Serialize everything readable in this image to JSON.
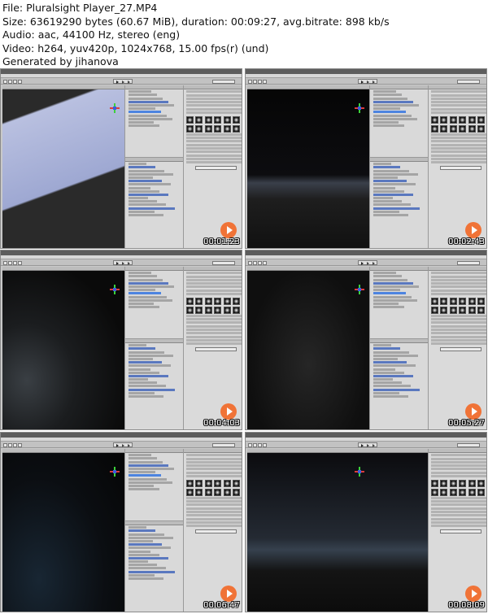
{
  "header": {
    "lines": [
      "File: Pluralsight Player_27.MP4",
      "Size: 63619290 bytes (60.67 MiB), duration: 00:09:27, avg.bitrate: 898 kb/s",
      "Audio: aac, 44100 Hz, stereo (eng)",
      "Video: h264, yuv420p, 1024x768, 15.00 fps(r) (und)",
      "Generated by jihanova"
    ]
  },
  "thumbnails": [
    {
      "timestamp": "00:01:23",
      "scene": "terrain-plane",
      "viewport": "narrow"
    },
    {
      "timestamp": "00:02:43",
      "scene": "dark-horizon",
      "viewport": "narrow"
    },
    {
      "timestamp": "00:04:03",
      "scene": "dark-forest",
      "viewport": "narrow"
    },
    {
      "timestamp": "00:05:27",
      "scene": "dark-gizmo",
      "viewport": "narrow"
    },
    {
      "timestamp": "00:06:47",
      "scene": "dark-night",
      "viewport": "narrow"
    },
    {
      "timestamp": "00:08:09",
      "scene": "dark-sky",
      "viewport": "wide"
    }
  ],
  "colors": {
    "watermark": "#f26b2a",
    "terrain_plane": "#a8b2d8",
    "dark_scene": "#141414"
  }
}
